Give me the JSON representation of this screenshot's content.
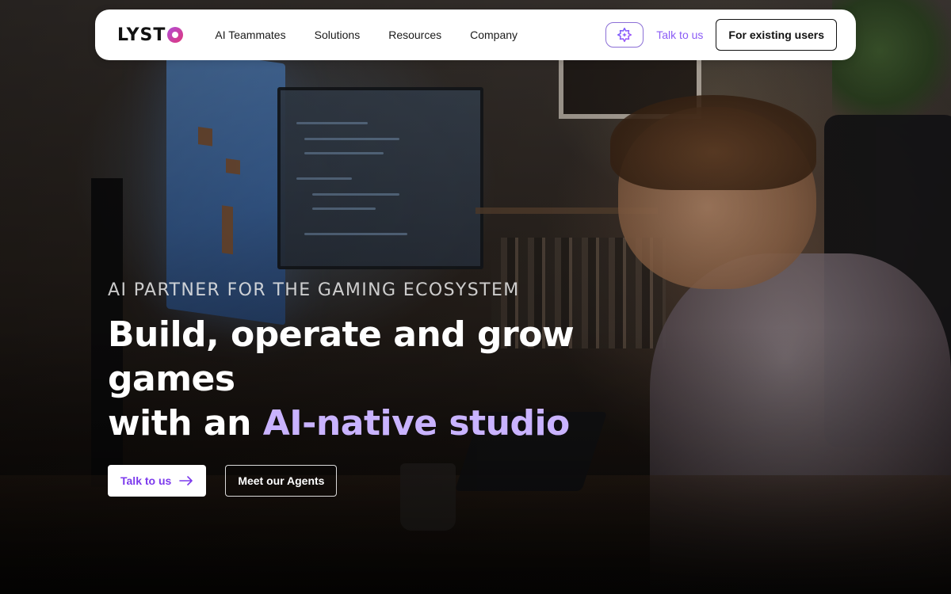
{
  "brand": {
    "logo_text": "LYST"
  },
  "nav": {
    "links": [
      {
        "label": "AI Teammates"
      },
      {
        "label": "Solutions"
      },
      {
        "label": "Resources"
      },
      {
        "label": "Company"
      }
    ],
    "ai_button_icon": "sparkle-gear-icon",
    "talk_link": "Talk to us",
    "existing_users_button": "For existing users"
  },
  "hero": {
    "eyebrow": "AI PARTNER FOR THE GAMING ECOSYSTEM",
    "headline_line1": "Build, operate and grow games",
    "headline_line2_prefix": "with an ",
    "headline_line2_accent": "AI-native studio",
    "cta_primary": "Talk to us",
    "cta_primary_icon": "arrow-right-icon",
    "cta_secondary": "Meet our Agents"
  },
  "colors": {
    "accent": "#8b5cf6",
    "headline_accent": "#c9b3ff",
    "logo_gradient_start": "#b04fd8",
    "logo_gradient_end": "#e0357a"
  }
}
